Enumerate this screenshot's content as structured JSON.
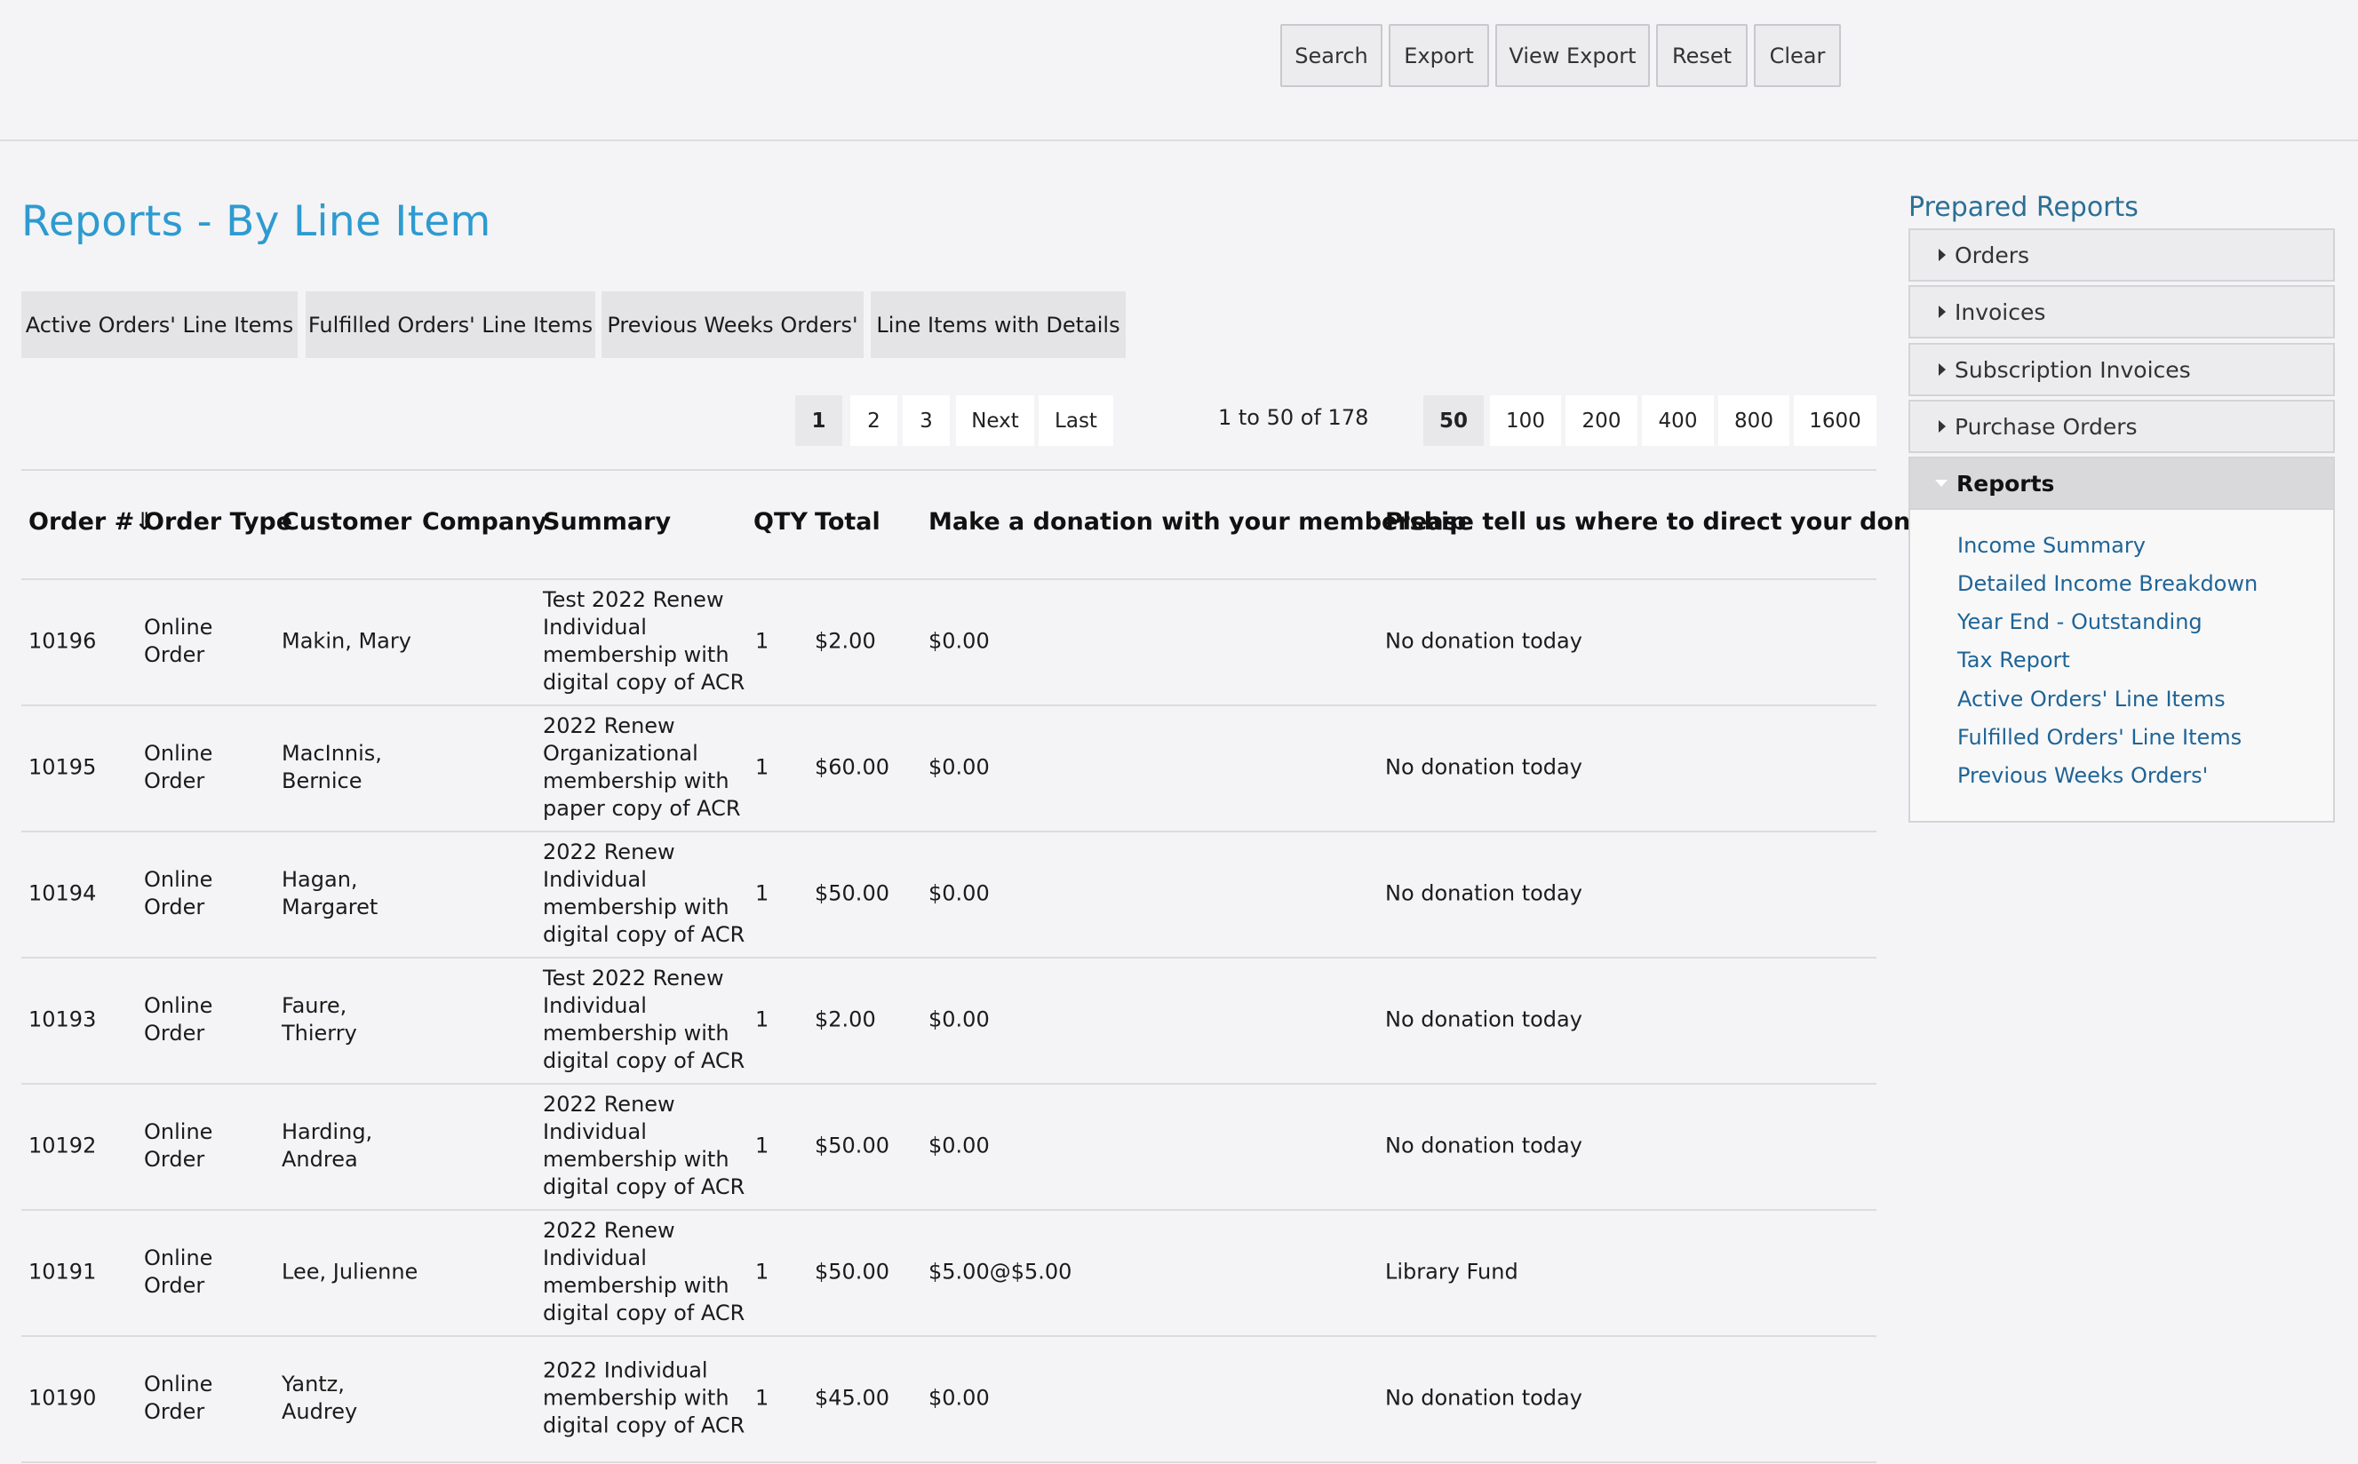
{
  "toolbar": {
    "buttons": [
      "Search",
      "Export",
      "View Export",
      "Reset",
      "Clear"
    ]
  },
  "page": {
    "title": "Reports - By Line Item"
  },
  "report_tabs": [
    "Active Orders' Line Items",
    "Fulfilled Orders' Line Items",
    "Previous Weeks Orders'",
    "Line Items with Details"
  ],
  "pagination": {
    "pages": [
      "1",
      "2",
      "3"
    ],
    "current_page": "1",
    "next_label": "Next",
    "last_label": "Last",
    "range_text": "1 to 50 of 178",
    "page_sizes": [
      "50",
      "100",
      "200",
      "400",
      "800",
      "1600"
    ],
    "current_page_size": "50"
  },
  "table": {
    "sort_icon": "sort-descending-icon",
    "columns": [
      "Order #⇓",
      "Order Type",
      "Customer",
      "Company",
      "Summary",
      "QTY",
      "Total",
      "Make a donation with your membership",
      "Please tell us where to direct your donation"
    ],
    "rows": [
      {
        "order": "10196",
        "type": "Online\nOrder",
        "customer": "Makin, Mary",
        "company": "",
        "summary": "Test 2022 Renew\nIndividual\nmembership with\ndigital copy of ACR",
        "qty": "1",
        "total": "$2.00",
        "donation": "$0.00",
        "direct": "No donation today"
      },
      {
        "order": "10195",
        "type": "Online\nOrder",
        "customer": "MacInnis,\nBernice",
        "company": "",
        "summary": "2022 Renew\nOrganizational\nmembership with\npaper copy of ACR",
        "qty": "1",
        "total": "$60.00",
        "donation": "$0.00",
        "direct": "No donation today"
      },
      {
        "order": "10194",
        "type": "Online\nOrder",
        "customer": "Hagan,\nMargaret",
        "company": "",
        "summary": "2022 Renew\nIndividual\nmembership with\ndigital copy of ACR",
        "qty": "1",
        "total": "$50.00",
        "donation": "$0.00",
        "direct": "No donation today"
      },
      {
        "order": "10193",
        "type": "Online\nOrder",
        "customer": "Faure,\nThierry",
        "company": "",
        "summary": "Test 2022 Renew\nIndividual\nmembership with\ndigital copy of ACR",
        "qty": "1",
        "total": "$2.00",
        "donation": "$0.00",
        "direct": "No donation today"
      },
      {
        "order": "10192",
        "type": "Online\nOrder",
        "customer": "Harding,\nAndrea",
        "company": "",
        "summary": "2022 Renew\nIndividual\nmembership with\ndigital copy of ACR",
        "qty": "1",
        "total": "$50.00",
        "donation": "$0.00",
        "direct": "No donation today"
      },
      {
        "order": "10191",
        "type": "Online\nOrder",
        "customer": "Lee, Julienne",
        "company": "",
        "summary": "2022 Renew\nIndividual\nmembership with\ndigital copy of ACR",
        "qty": "1",
        "total": "$50.00",
        "donation": "$5.00@$5.00",
        "direct": "Library Fund"
      },
      {
        "order": "10190",
        "type": "Online\nOrder",
        "customer": "Yantz,\nAudrey",
        "company": "",
        "summary": "2022 Individual\nmembership with\ndigital copy of ACR",
        "qty": "1",
        "total": "$45.00",
        "donation": "$0.00",
        "direct": "No donation today"
      }
    ]
  },
  "sidebar": {
    "title": "Prepared Reports",
    "sections": [
      "Orders",
      "Invoices",
      "Subscription Invoices",
      "Purchase Orders",
      "Reports"
    ],
    "open_section": "Reports",
    "collapsed_icon": "caret-right-icon",
    "expanded_icon": "caret-down-icon",
    "report_links": [
      "Income Summary",
      "Detailed Income Breakdown",
      "Year End - Outstanding",
      "Tax Report",
      "Active Orders' Line Items",
      "Fulfilled Orders' Line Items",
      "Previous Weeks Orders'"
    ]
  },
  "colors": {
    "title_blue": "#2e9bd0",
    "link_blue": "#1f6496",
    "sidebar_title": "#2b6f95",
    "background": "#f4f4f6"
  }
}
